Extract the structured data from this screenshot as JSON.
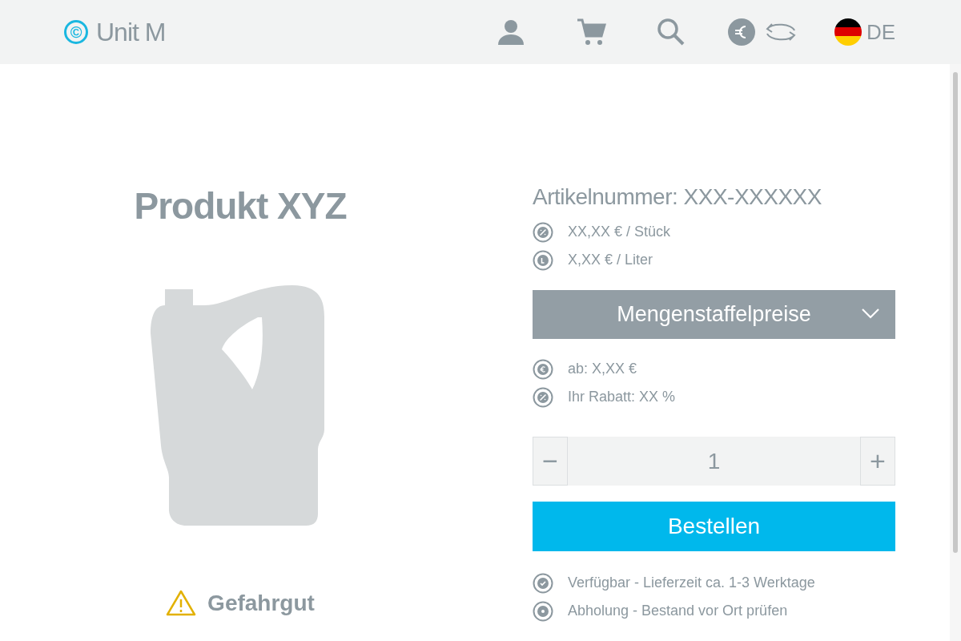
{
  "header": {
    "logo_mark": "©",
    "logo_text": "Unit M",
    "language": "DE"
  },
  "product": {
    "title": "Produkt XYZ",
    "hazard_label": "Gefahrgut"
  },
  "details": {
    "article_number": "Artikelnummer: XXX-XXXXXX",
    "prices": [
      "XX,XX € / Stück",
      "X,XX € / Liter"
    ],
    "tier_dropdown": {
      "label": "Mengenstaffelpreise",
      "expanded": false
    },
    "tier_info": [
      "ab: X,XX €",
      "Ihr Rabatt: XX %"
    ],
    "quantity": {
      "minus": "−",
      "value": "1",
      "plus": "+"
    },
    "order_button": "Bestellen",
    "availability": [
      "Verfügbar - Lieferzeit ca. 1-3 Werktage",
      "Abholung - Bestand vor Ort prüfen"
    ]
  }
}
